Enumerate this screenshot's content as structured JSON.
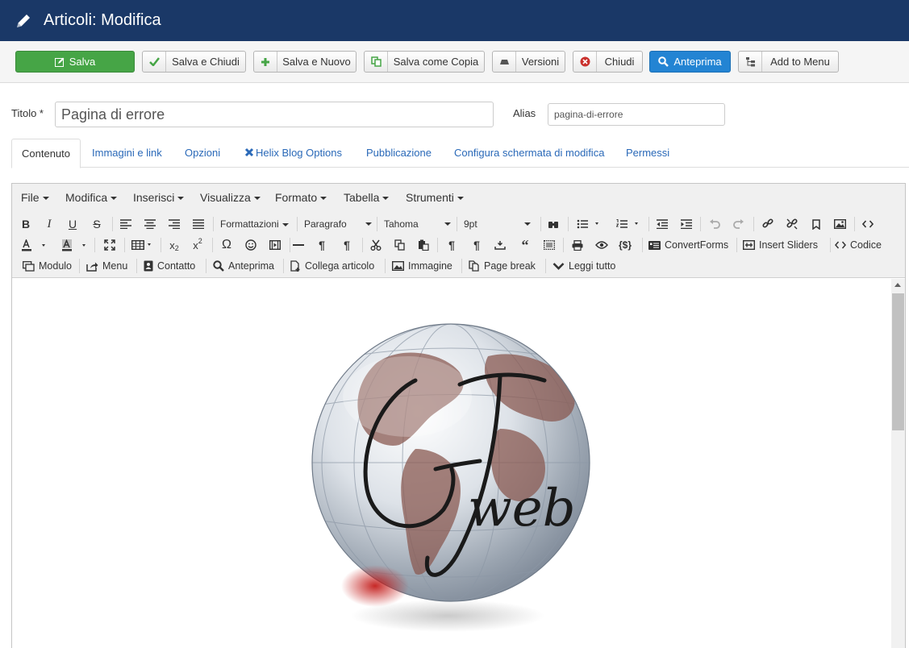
{
  "header": {
    "title": "Articoli: Modifica",
    "icon": "pencil-icon"
  },
  "toolbar": {
    "save": "Salva",
    "save_close": "Salva e Chiudi",
    "save_new": "Salva e Nuovo",
    "save_copy": "Salva come Copia",
    "versions": "Versioni",
    "close": "Chiudi",
    "preview": "Anteprima",
    "add_to_menu": "Add to Menu"
  },
  "form": {
    "title_label": "Titolo *",
    "title_value": "Pagina di errore",
    "alias_label": "Alias",
    "alias_value": "pagina-di-errore"
  },
  "tabs": [
    "Contenuto",
    "Immagini e link",
    "Opzioni",
    "Helix Blog Options",
    "Pubblicazione",
    "Configura schermata di modifica",
    "Permessi"
  ],
  "editor": {
    "menu": [
      "File",
      "Modifica",
      "Inserisci",
      "Visualizza",
      "Formato",
      "Tabella",
      "Strumenti"
    ],
    "formats": "Formattazioni",
    "block": "Paragrafo",
    "font": "Tahoma",
    "size": "9pt",
    "convertforms": "ConvertForms",
    "insert_sliders": "Insert Sliders",
    "code": "Codice",
    "buttons": {
      "module": "Modulo",
      "menu": "Menu",
      "contact": "Contatto",
      "preview": "Anteprima",
      "link_article": "Collega articolo",
      "image": "Immagine",
      "page_break": "Page break",
      "read_more": "Leggi tutto"
    }
  },
  "content": {
    "logo_text_main": "GT",
    "logo_text_sub": "web"
  },
  "colors": {
    "header": "#1a3867",
    "save_green": "#46a546",
    "preview_blue": "#2384d3",
    "link": "#2a69b8"
  }
}
